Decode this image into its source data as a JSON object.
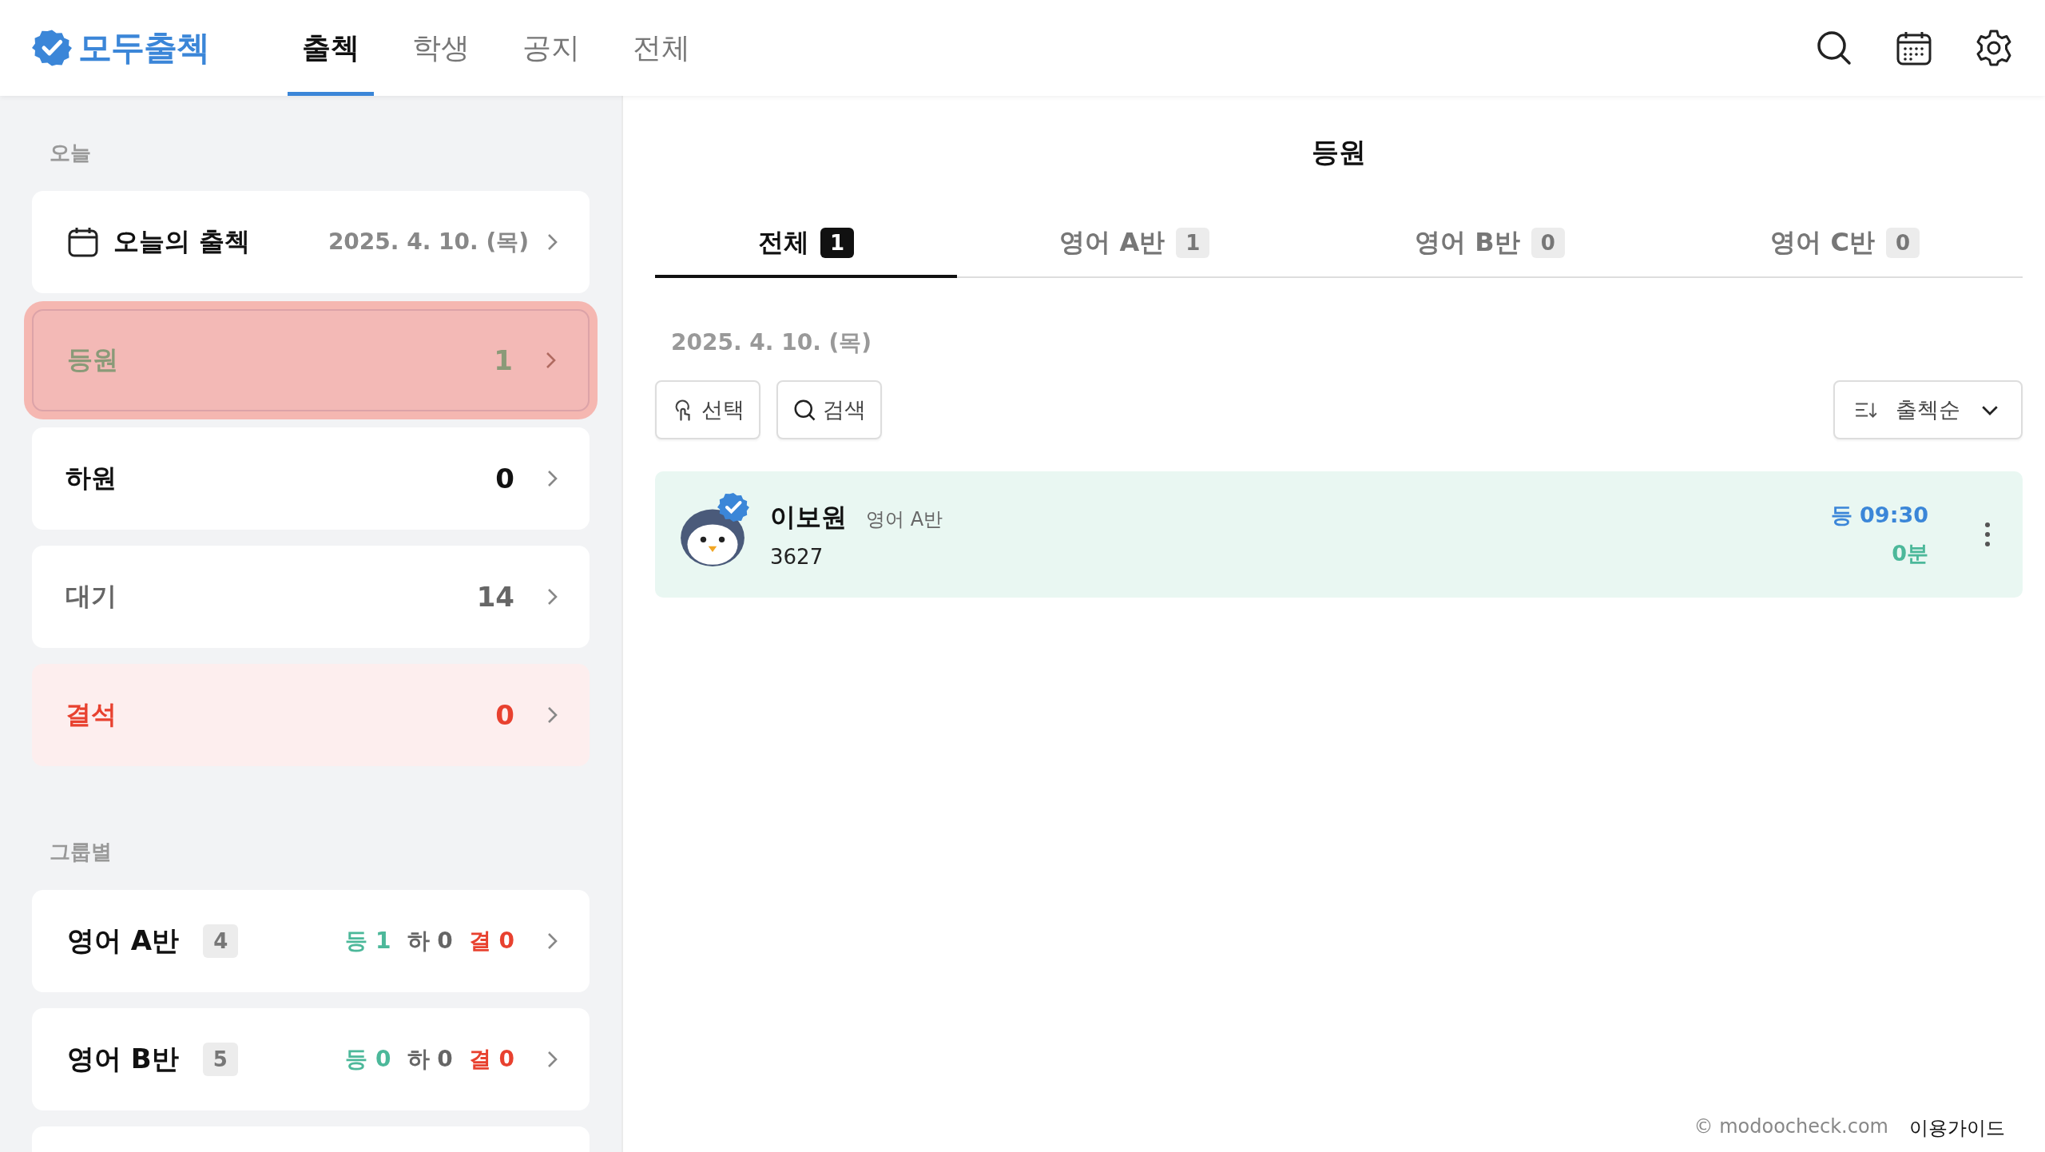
{
  "header": {
    "logo": "모두출첵",
    "nav": [
      {
        "label": "출첵",
        "selected": true
      },
      {
        "label": "학생",
        "selected": false
      },
      {
        "label": "공지",
        "selected": false
      },
      {
        "label": "전체",
        "selected": false
      }
    ]
  },
  "sidebar": {
    "today_heading": "오늘",
    "today": {
      "label": "오늘의 출첵",
      "date": "2025. 4. 10. (목)"
    },
    "statuses": [
      {
        "kind": "arrive",
        "label": "등원",
        "count": "1",
        "selected": true
      },
      {
        "kind": "leave",
        "label": "하원",
        "count": "0",
        "selected": false
      },
      {
        "kind": "wait",
        "label": "대기",
        "count": "14",
        "selected": false
      },
      {
        "kind": "absent",
        "label": "결석",
        "count": "0",
        "selected": false
      }
    ],
    "group_heading": "그룹별",
    "groups": [
      {
        "name": "영어 A반",
        "size": "4",
        "stats": [
          {
            "kind": "arrive",
            "label": "등",
            "count": "1"
          },
          {
            "kind": "leave",
            "label": "하",
            "count": "0"
          },
          {
            "kind": "absent",
            "label": "결",
            "count": "0"
          }
        ]
      },
      {
        "name": "영어 B반",
        "size": "5",
        "stats": [
          {
            "kind": "arrive",
            "label": "등",
            "count": "0"
          },
          {
            "kind": "leave",
            "label": "하",
            "count": "0"
          },
          {
            "kind": "absent",
            "label": "결",
            "count": "0"
          }
        ]
      }
    ]
  },
  "main": {
    "title": "등원",
    "tabs": [
      {
        "label": "전체",
        "count": "1",
        "selected": true
      },
      {
        "label": "영어 A반",
        "count": "1",
        "selected": false
      },
      {
        "label": "영어 B반",
        "count": "0",
        "selected": false
      },
      {
        "label": "영어 C반",
        "count": "0",
        "selected": false
      }
    ],
    "date": "2025. 4. 10. (목)",
    "buttons": [
      {
        "kind": "select",
        "label": "선택"
      },
      {
        "kind": "search",
        "label": "검색"
      }
    ],
    "sort": {
      "label": "출첵순"
    },
    "students": [
      {
        "name": "이보원",
        "group": "영어 A반",
        "code": "3627",
        "time": "등 09:30",
        "elapsed": "0분",
        "verified": true
      }
    ]
  },
  "footer": {
    "copyright": "© modoocheck.com",
    "guide": "이용가이드"
  }
}
